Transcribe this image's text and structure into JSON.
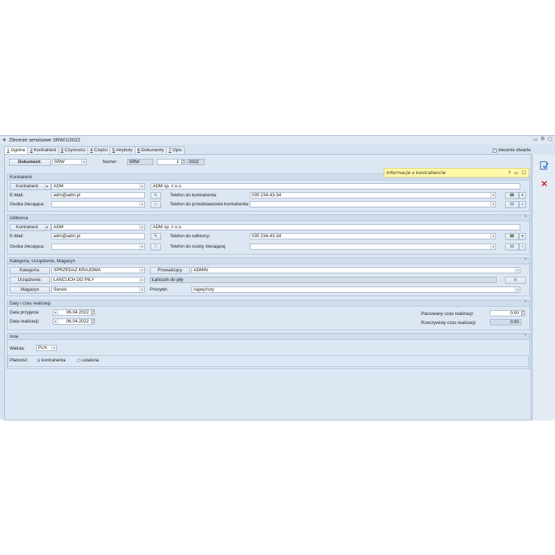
{
  "window": {
    "title": "Zlecenie serwisowe SRW/1/2022",
    "controls": [
      "▭",
      "⧉",
      "☐"
    ]
  },
  "tabs": [
    {
      "num": "1",
      "label": "Ogólne"
    },
    {
      "num": "2",
      "label": "Kontrahent"
    },
    {
      "num": "3",
      "label": "Czynności"
    },
    {
      "num": "4",
      "label": "Części"
    },
    {
      "num": "5",
      "label": "Atrybuty"
    },
    {
      "num": "6",
      "label": "Dokumenty"
    },
    {
      "num": "7",
      "label": "Opis"
    }
  ],
  "zlecenie_otwarte": {
    "label": "zlecenie otwarte",
    "checked": true
  },
  "dokument": {
    "label": "Dokument:",
    "type": "SRW",
    "numer_label": "Numer:",
    "numer_prefix": "SRW",
    "numer_value": "1",
    "numer_year": "2022"
  },
  "popup": {
    "title": "Informacje o kontrahencie",
    "buttons": [
      "?",
      "▭",
      "☐"
    ]
  },
  "kontrahent": {
    "section_title": "Kontrahent",
    "kontrahent_btn": "Kontrahent",
    "code": "ADM",
    "name": "ADM sp. z o.o.",
    "email_label": "E-Mail:",
    "email": "adm@adm.pl",
    "phone_label": "Telefon do kontrahenta:",
    "phone": "035 234-43-34",
    "osoba_label": "Osoba zlecająca:",
    "osoba": "",
    "phone_rep_label": "Telefon do przedstawiciela kontrahenta:",
    "phone_rep": ""
  },
  "odbiorca": {
    "section_title": "Odbiorca",
    "kontrahent_btn": "Kontrahent",
    "code": "ADM",
    "name": "ADM sp. z o.o.",
    "email_label": "E-Mail:",
    "email": "adm@adm.pl",
    "phone_label": "Telefon do odbiorcy:",
    "phone": "035 234-43-34",
    "osoba_label": "Osoba zlecająca:",
    "osoba": "",
    "phone_os_label": "Telefon do osoby zlecającej:",
    "phone_os": ""
  },
  "kategoria": {
    "section_title": "Kategoria, Urządzenie, Magazyn",
    "kategoria_btn": "Kategoria:",
    "kategoria": "SPRZEDAŻ KRAJOWA",
    "prowadzacy_btn": "Prowadzący",
    "prowadzacy": "ADMIN",
    "urzadzenie_btn": "Urządzenie:",
    "urzadzenie": "ŁAŃCUCH DO PIŁY",
    "urzadzenie_name": "Łańcuch do piły",
    "magazyn_btn": "Magazyn",
    "magazyn": "Serwis",
    "priorytet_label": "Priorytet:",
    "priorytet": "najwyższy"
  },
  "daty": {
    "section_title": "Daty i czas realizacji",
    "przyjecia_label": "Data przyjęcia:",
    "przyjecia": "06.04.2022",
    "realizacji_label": "Data realizacji:",
    "realizacji": "06.04.2022",
    "planowany_label": "Planowany czas realizacji:",
    "planowany": "0:00",
    "rzeczywisty_label": "Rzeczywisty czas realizacji:",
    "rzeczywisty": "0:00"
  },
  "inne": {
    "section_title": "Inne",
    "waluta_label": "Waluta:",
    "waluta": "PLN",
    "platnosc_label": "Płatność:",
    "opt1": "kontrahenta",
    "opt2": "ustalona"
  },
  "icons": {
    "save": "save-icon",
    "cancel": "cancel-icon"
  },
  "colors": {
    "accent": "#4a6a96",
    "popup": "#fff9a8",
    "cancel": "#d42020"
  }
}
